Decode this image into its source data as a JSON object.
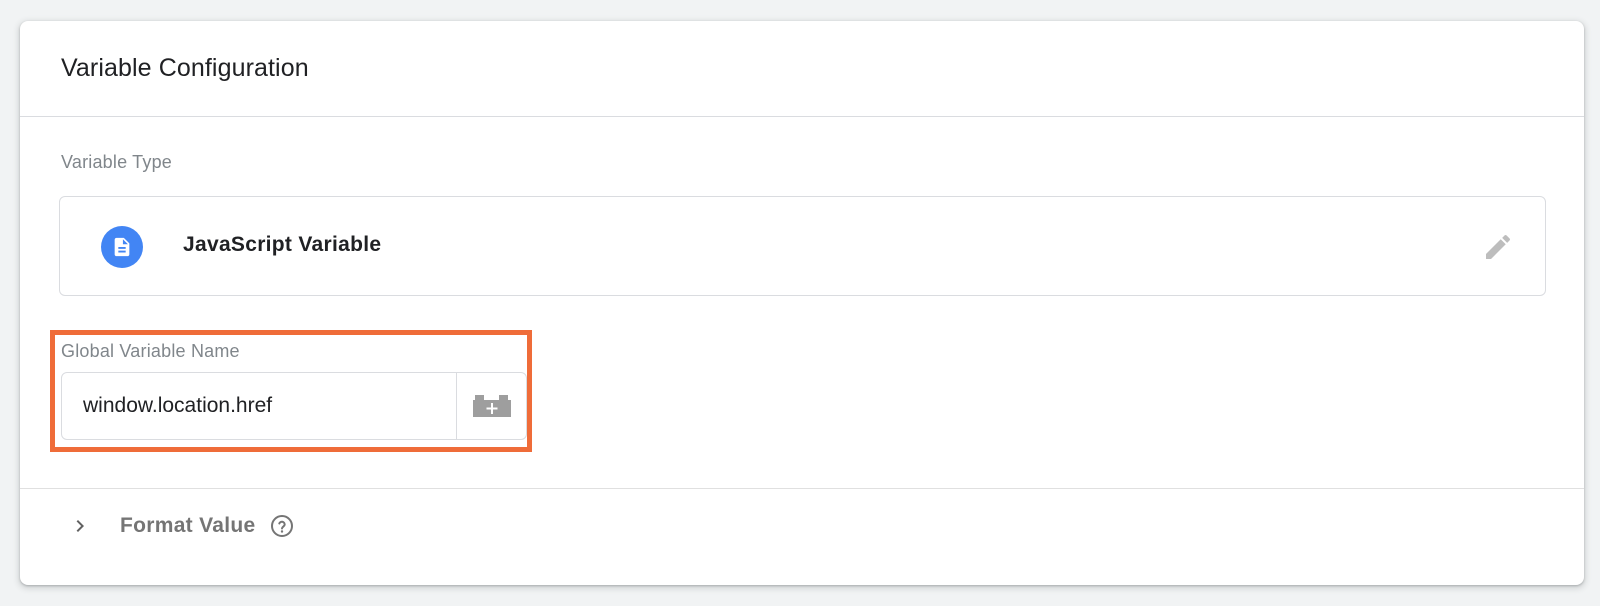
{
  "card": {
    "title": "Variable Configuration"
  },
  "variable_type": {
    "label": "Variable Type",
    "name": "JavaScript Variable",
    "icon": "document-icon",
    "icon_color": "#4285f4",
    "edit_icon": "pencil-icon"
  },
  "global_variable": {
    "label": "Global Variable Name",
    "value": "window.location.href",
    "picker_icon": "add-variable-icon",
    "highlight_color": "#ef6c39"
  },
  "format_value": {
    "label": "Format Value",
    "expand_icon": "chevron-right-icon",
    "help_icon": "help-icon"
  }
}
